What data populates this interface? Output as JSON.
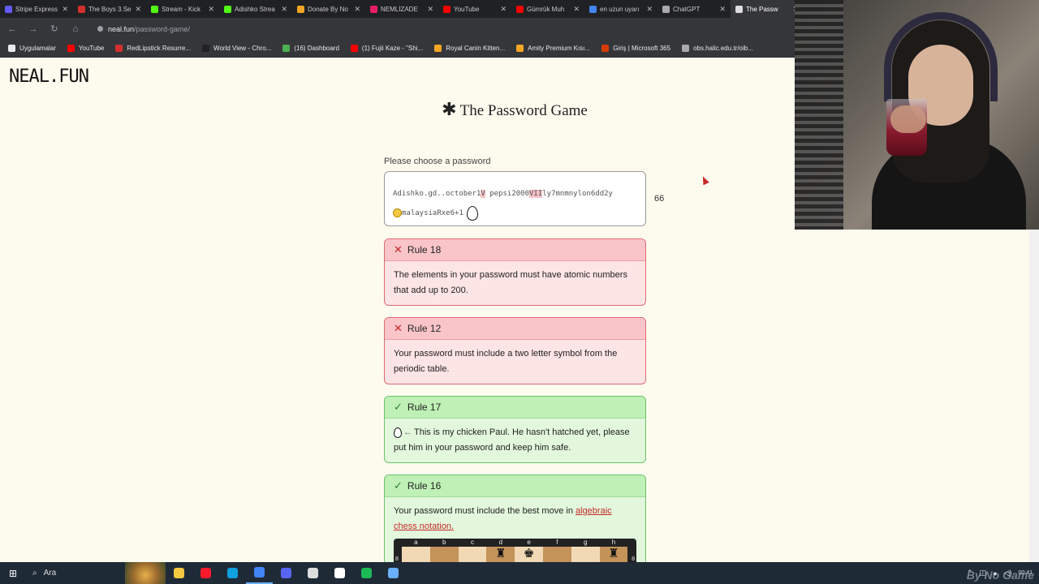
{
  "browser": {
    "tabs": [
      {
        "label": "Stripe Express",
        "color": "#635bff",
        "active": false
      },
      {
        "label": "The Boys 3.Se",
        "color": "#d32f2f",
        "active": false
      },
      {
        "label": "Stream - Kick",
        "color": "#53fc18",
        "active": false
      },
      {
        "label": "Adishko Strea",
        "color": "#53fc18",
        "active": false
      },
      {
        "label": "Donate By No",
        "color": "#f5a623",
        "active": false
      },
      {
        "label": "NEMLİZADE",
        "color": "#e91e63",
        "active": false
      },
      {
        "label": "YouTube",
        "color": "#ff0000",
        "active": false
      },
      {
        "label": "Gümrük Muh",
        "color": "#ff0000",
        "active": false
      },
      {
        "label": "en uzun uyarı",
        "color": "#4285f4",
        "active": false
      },
      {
        "label": "ChatGPT",
        "color": "#aaaaaa",
        "active": false
      },
      {
        "label": "The Passw",
        "color": "#dddddd",
        "active": true
      }
    ],
    "url_host": "neal.fun",
    "url_path": "/password-game/",
    "bookmarks": [
      {
        "label": "Uygulamalar",
        "color": "#e8eaed"
      },
      {
        "label": "YouTube",
        "color": "#ff0000"
      },
      {
        "label": "RedLipstick Resurre...",
        "color": "#d32f2f"
      },
      {
        "label": "World View - Chro...",
        "color": "#222222"
      },
      {
        "label": "(16) Dashboard",
        "color": "#4caf50"
      },
      {
        "label": "(1) Fujii Kaze - \"Shi...",
        "color": "#ff0000"
      },
      {
        "label": "Royal Canin Kitten...",
        "color": "#f5a623"
      },
      {
        "label": "Amity Premium Kısı...",
        "color": "#f5a623"
      },
      {
        "label": "Giriş | Microsoft 365",
        "color": "#d83b01"
      },
      {
        "label": "obs.halic.edu.tr/oib...",
        "color": "#aaaaaa"
      }
    ]
  },
  "page": {
    "logo": "NEAL.FUN",
    "title": "The Password Game",
    "prompt": "Please choose a password",
    "password": {
      "part1": "Adishko.gd..october1",
      "hl1": "V",
      "part2": " pepsi2000",
      "hl2": "VII",
      "part3": "ly7mnmnylon6dd2y",
      "part4": "malaysiaRxe6+1"
    },
    "char_count": "66",
    "rules": [
      {
        "status": "fail",
        "mark": "✕",
        "title": "Rule 18",
        "body": "The elements in your password must have atomic numbers that add up to 200."
      },
      {
        "status": "fail",
        "mark": "✕",
        "title": "Rule 12",
        "body": "Your password must include a two letter symbol from the periodic table."
      },
      {
        "status": "pass",
        "mark": "✓",
        "title": "Rule 17",
        "arrow": "←",
        "body": "This is my chicken Paul. He hasn't hatched yet, please put him in your password and keep him safe."
      },
      {
        "status": "pass",
        "mark": "✓",
        "title": "Rule 16",
        "body_before": "Your password must include the best move in ",
        "link": "algebraic chess notation."
      }
    ],
    "chess": {
      "files": [
        "a",
        "b",
        "c",
        "d",
        "e",
        "f",
        "g",
        "h"
      ],
      "rank": "8",
      "pieces": [
        "",
        "",
        "",
        "♜",
        "♚",
        "",
        "",
        "♜"
      ]
    }
  },
  "taskbar": {
    "search_label": "Ara",
    "apps": [
      {
        "name": "file-explorer",
        "color": "#f5c842"
      },
      {
        "name": "opera",
        "color": "#ff1b2d"
      },
      {
        "name": "edge",
        "color": "#0fa0e0"
      },
      {
        "name": "chrome",
        "color": "#4285f4"
      },
      {
        "name": "discord",
        "color": "#5865f2"
      },
      {
        "name": "obs",
        "color": "#dddddd"
      },
      {
        "name": "app",
        "color": "#ffffff"
      },
      {
        "name": "spotify",
        "color": "#1db954"
      },
      {
        "name": "pc",
        "color": "#6ab0ff"
      }
    ],
    "clock": "00:41",
    "watermark": "By No Game"
  }
}
